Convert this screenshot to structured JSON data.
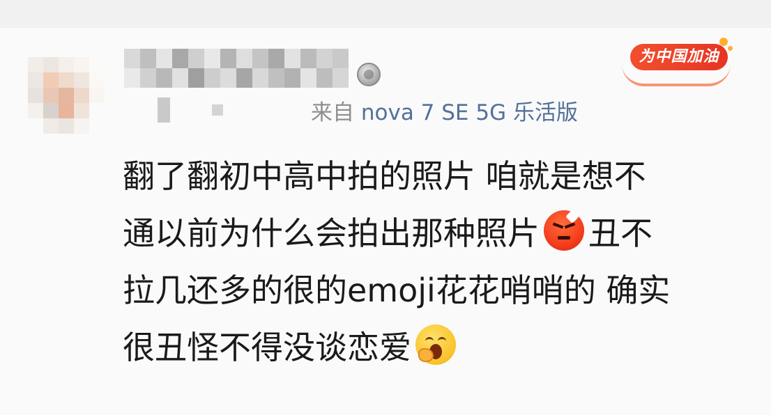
{
  "comment_card": {
    "device_prefix": "来自 ",
    "device_name": "nova 7 SE 5G 乐活版",
    "cheer_badge_label": "为中国加油",
    "comment_lines": [
      [
        "翻了翻初中高中拍的照片 咱就是想不"
      ],
      [
        "通以前为什么会拍出那种照片",
        "丑不"
      ],
      [
        "拉几还多的很的emoji花花哨哨的 确实"
      ],
      [
        "很丑怪不得没谈恋爱"
      ]
    ],
    "emojis": {
      "angry": "angry-face-icon",
      "yawn": "yawning-face-icon"
    },
    "colors": {
      "device_prefix": "#8f8f8f",
      "device_name": "#53719a",
      "comment_text": "#1a1a1a",
      "badge_red": "#e63523"
    }
  }
}
